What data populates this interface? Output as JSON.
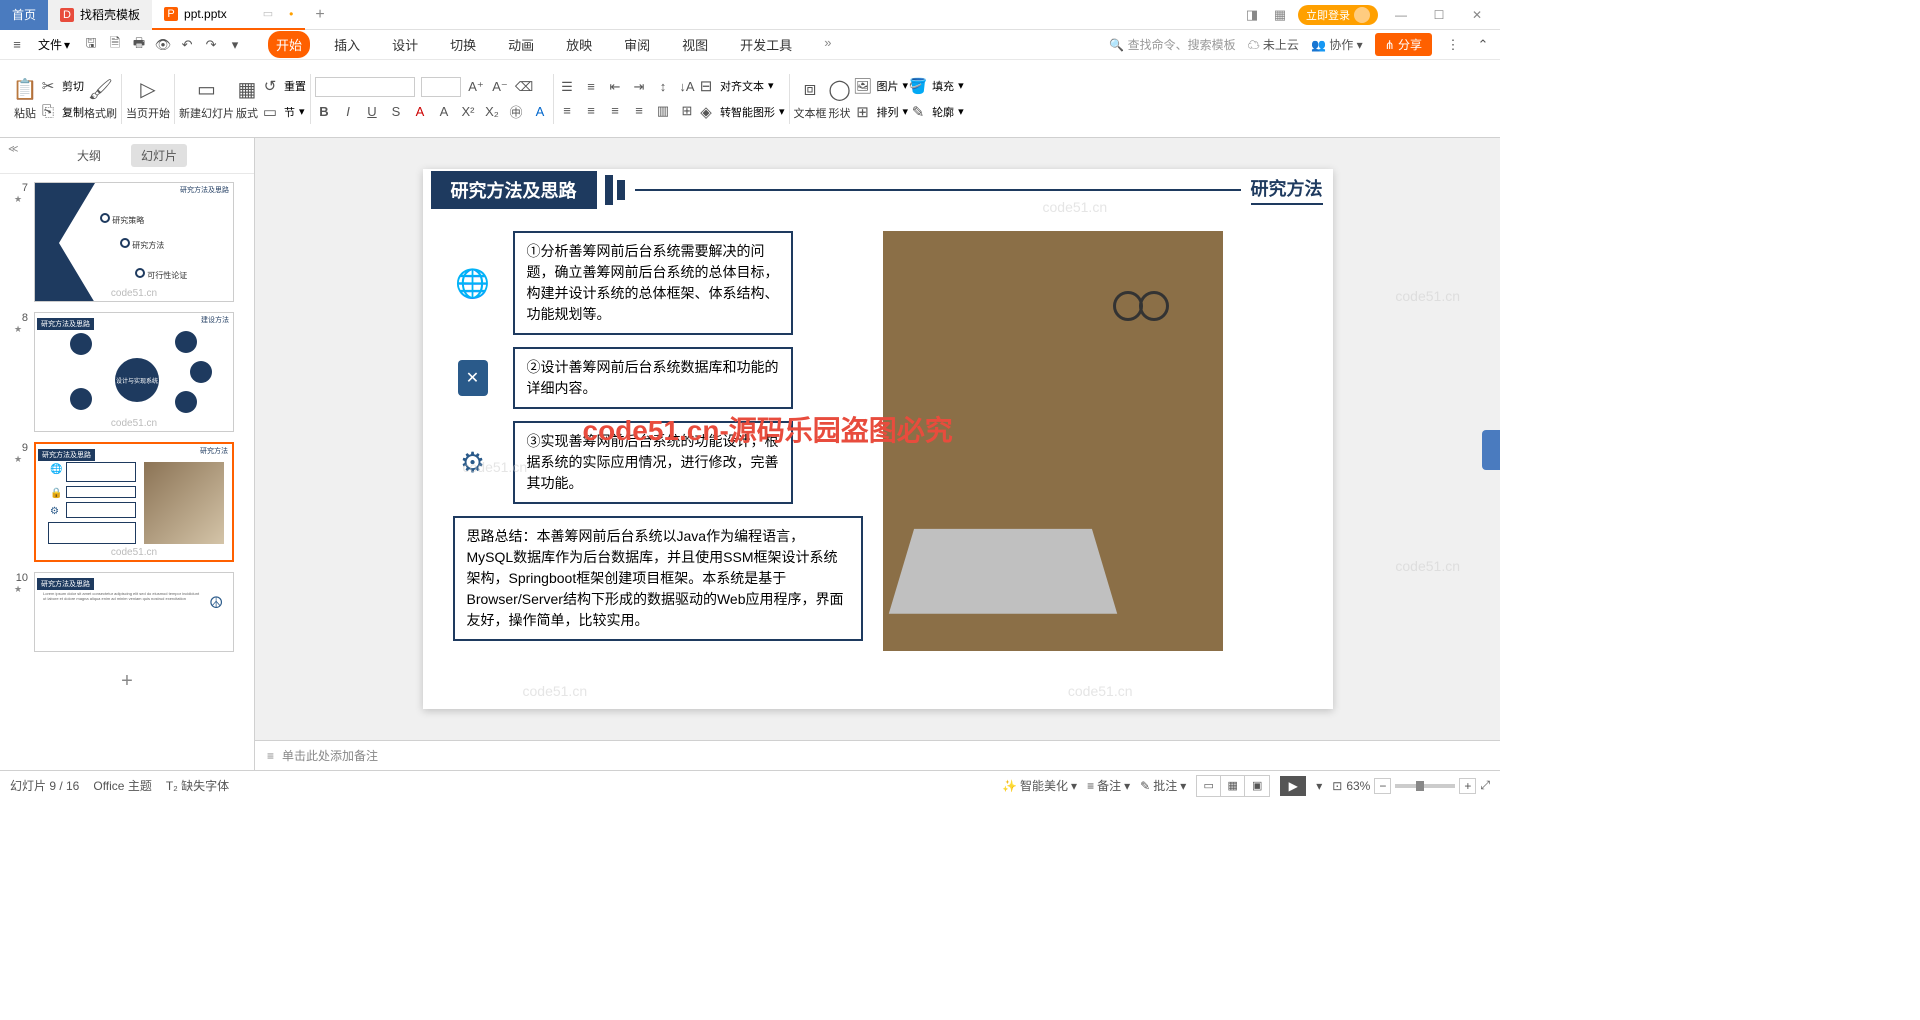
{
  "titlebar": {
    "home": "首页",
    "docer": "找稻壳模板",
    "file": "ppt.pptx",
    "login": "立即登录"
  },
  "menubar": {
    "file": "文件",
    "tabs": [
      "开始",
      "插入",
      "设计",
      "切换",
      "动画",
      "放映",
      "审阅",
      "视图",
      "开发工具"
    ],
    "active_idx": 0,
    "search": "查找命令、搜索模板",
    "cloud": "未上云",
    "collab": "协作",
    "share": "分享"
  },
  "ribbon": {
    "paste": "粘贴",
    "cut": "剪切",
    "copy": "复制",
    "format_painter": "格式刷",
    "from_current": "当页开始",
    "new_slide": "新建幻灯片",
    "layout": "版式",
    "reset": "重置",
    "section": "节",
    "align_text": "对齐文本",
    "smartart": "转智能图形",
    "textbox": "文本框",
    "shape": "形状",
    "picture": "图片",
    "arrange": "排列",
    "fill": "填充",
    "outline": "轮廓"
  },
  "sidebar": {
    "outline": "大纲",
    "slides": "幻灯片",
    "thumbs": [
      {
        "num": "7"
      },
      {
        "num": "8"
      },
      {
        "num": "9"
      },
      {
        "num": "10"
      }
    ],
    "watermark": "code51.cn"
  },
  "slide": {
    "title": "研究方法及思路",
    "subtitle": "研究方法",
    "box1": "①分析善筹网前后台系统需要解决的问题，确立善筹网前后台系统的总体目标，构建并设计系统的总体框架、体系结构、功能规划等。",
    "box2": "②设计善筹网前后台系统数据库和功能的详细内容。",
    "box3": "③实现善筹网前后台系统的功能设计，根据系统的实际应用情况，进行修改，完善其功能。",
    "summary": "思路总结：本善筹网前后台系统以Java作为编程语言，MySQL数据库作为后台数据库，并且使用SSM框架设计系统架构，Springboot框架创建项目框架。本系统是基于Browser/Server结构下形成的数据驱动的Web应用程序，界面友好，操作简单，比较实用。",
    "watermark_red": "code51.cn-源码乐园盗图必究",
    "watermark_gray": "code51.cn"
  },
  "notes": {
    "placeholder": "单击此处添加备注"
  },
  "statusbar": {
    "slide_info": "幻灯片 9 / 16",
    "theme": "Office 主题",
    "missing_font": "缺失字体",
    "beautify": "智能美化",
    "notes": "备注",
    "comments": "批注",
    "zoom": "63%"
  },
  "thumb7": {
    "title": "研究方法及思路",
    "i1": "研究策略",
    "i2": "研究方法",
    "i3": "可行性论证"
  },
  "thumb8": {
    "title": "研究方法及思路",
    "sub": "建设方法",
    "center": "设计与实现系统"
  }
}
